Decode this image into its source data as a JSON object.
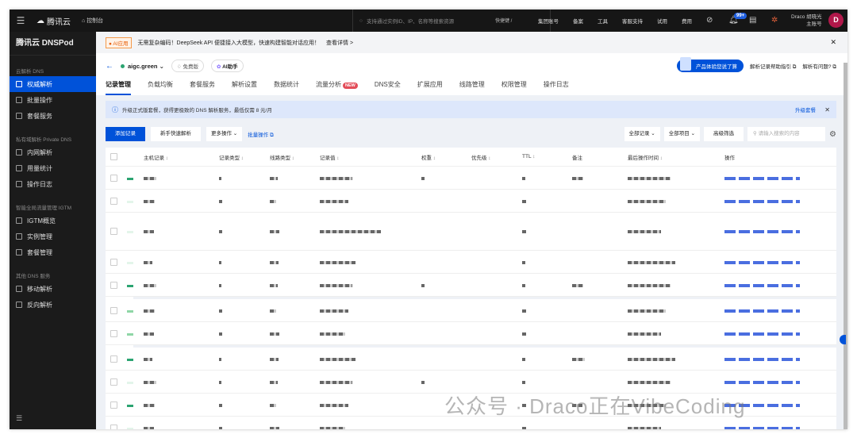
{
  "topbar": {
    "brand": "腾讯云",
    "console": "控制台",
    "search_placeholder": "支持通过实例ID、IP、名称等搜索资源",
    "shortcut": "快捷键 /",
    "links": [
      "集团账号",
      "备案",
      "工具",
      "客服支持",
      "试用",
      "费用"
    ],
    "notifications": "99+",
    "user_name": "Draco 胡晓光",
    "user_role": "主账号",
    "avatar": "D"
  },
  "sidebar": {
    "title": "腾讯云 DNSPod",
    "sections": [
      {
        "label": "云解析 DNS",
        "items": [
          {
            "label": "权威解析",
            "active": true
          },
          {
            "label": "批量操作"
          },
          {
            "label": "套餐服务"
          }
        ]
      },
      {
        "label": "私有域解析 Private DNS",
        "items": [
          {
            "label": "内网解析"
          },
          {
            "label": "用量统计"
          },
          {
            "label": "操作日志"
          }
        ]
      },
      {
        "label": "智能全局流量管理 IGTM",
        "items": [
          {
            "label": "IGTM概览"
          },
          {
            "label": "实例管理"
          },
          {
            "label": "套餐管理"
          }
        ]
      },
      {
        "label": "其他 DNS 服务",
        "items": [
          {
            "label": "移动解析"
          },
          {
            "label": "反向解析"
          }
        ]
      }
    ]
  },
  "announcement": {
    "tag": "AI应用",
    "text": "无需复杂编码！DeepSeek API 便捷接入大模型，快速构建智能对话应用！",
    "link": "查看详情 >"
  },
  "header": {
    "domain": "aigc.green",
    "plan": "免费版",
    "ai": "AI助手",
    "survey": "产品体验您说了算",
    "help": "解析记录帮助指引",
    "problem": "解析有问题?"
  },
  "tabs": [
    {
      "label": "记录管理",
      "active": true
    },
    {
      "label": "负载均衡"
    },
    {
      "label": "套餐服务"
    },
    {
      "label": "解析设置"
    },
    {
      "label": "数据统计"
    },
    {
      "label": "流量分析",
      "badge": "NEW"
    },
    {
      "label": "DNS安全"
    },
    {
      "label": "扩展应用"
    },
    {
      "label": "线路管理"
    },
    {
      "label": "权限管理"
    },
    {
      "label": "操作日志"
    }
  ],
  "info": {
    "text": "升级正式版套餐，获得更极致的 DNS 解析服务，最低仅需 8 元/月",
    "action": "升级套餐"
  },
  "toolbar": {
    "add": "添加记录",
    "quick": "新手快速解析",
    "more": "更多操作",
    "batch": "批量操作",
    "all_records": "全部记录",
    "all_projects": "全部项目",
    "advanced": "高级筛选",
    "search_placeholder": "请输入搜索的内容"
  },
  "table": {
    "columns": [
      "主机记录",
      "记录类型",
      "线路类型",
      "记录值",
      "权重",
      "优先级",
      "TTL",
      "备注",
      "最后操作时间",
      "操作"
    ],
    "rows": [
      {
        "status": "on"
      },
      {
        "status": "off"
      },
      {
        "status": "off",
        "tall": true
      },
      {
        "status": "off"
      },
      {
        "status": "on",
        "sep": true
      },
      {
        "status": "mid"
      },
      {
        "status": "mid",
        "sep": true
      },
      {
        "status": "on"
      },
      {
        "status": "off"
      },
      {
        "status": "on"
      },
      {
        "status": "off"
      }
    ]
  },
  "watermark": "公众号 · Draco正在VibeCoding"
}
